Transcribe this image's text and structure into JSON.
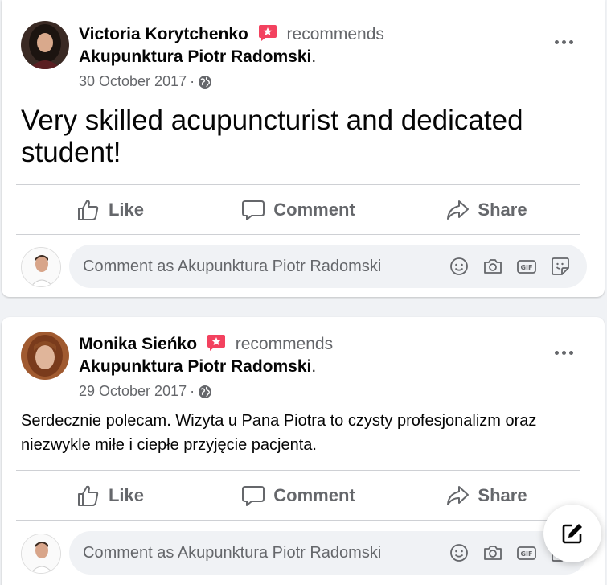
{
  "posts": [
    {
      "author": "Victoria Korytchenko",
      "recommends_word": "recommends",
      "page_name": "Akupunktura Piotr Radomski",
      "page_suffix": ".",
      "date": "30 October 2017",
      "date_separator": "·",
      "text": "Very skilled acupuncturist and dedicated student!",
      "actions": {
        "like": "Like",
        "comment": "Comment",
        "share": "Share"
      },
      "comment_placeholder": "Comment as Akupunktura Piotr Radomski"
    },
    {
      "author": "Monika Sieńko",
      "recommends_word": "recommends",
      "page_name": "Akupunktura Piotr Radomski",
      "page_suffix": ".",
      "date": "29 October 2017",
      "date_separator": "·",
      "text": "Serdecznie polecam. Wizyta u Pana Piotra to czysty profesjonalizm oraz niezwykle miłe i ciepłe przyjęcie pacjenta.",
      "actions": {
        "like": "Like",
        "comment": "Comment",
        "share": "Share"
      },
      "comment_placeholder": "Comment as Akupunktura Piotr Radomski"
    }
  ],
  "icons": {
    "recommend_badge": "recommend-star-icon",
    "privacy": "globe-icon",
    "more": "more-options-icon",
    "like": "thumbs-up-icon",
    "comment": "speech-bubble-icon",
    "share": "share-arrow-icon",
    "emoji": "smiley-icon",
    "camera": "camera-icon",
    "gif": "gif-icon",
    "sticker": "sticker-icon",
    "compose": "compose-icon"
  },
  "colors": {
    "background": "#f0f2f5",
    "card": "#ffffff",
    "secondary_text": "#65676b",
    "badge": "#f3425f"
  }
}
